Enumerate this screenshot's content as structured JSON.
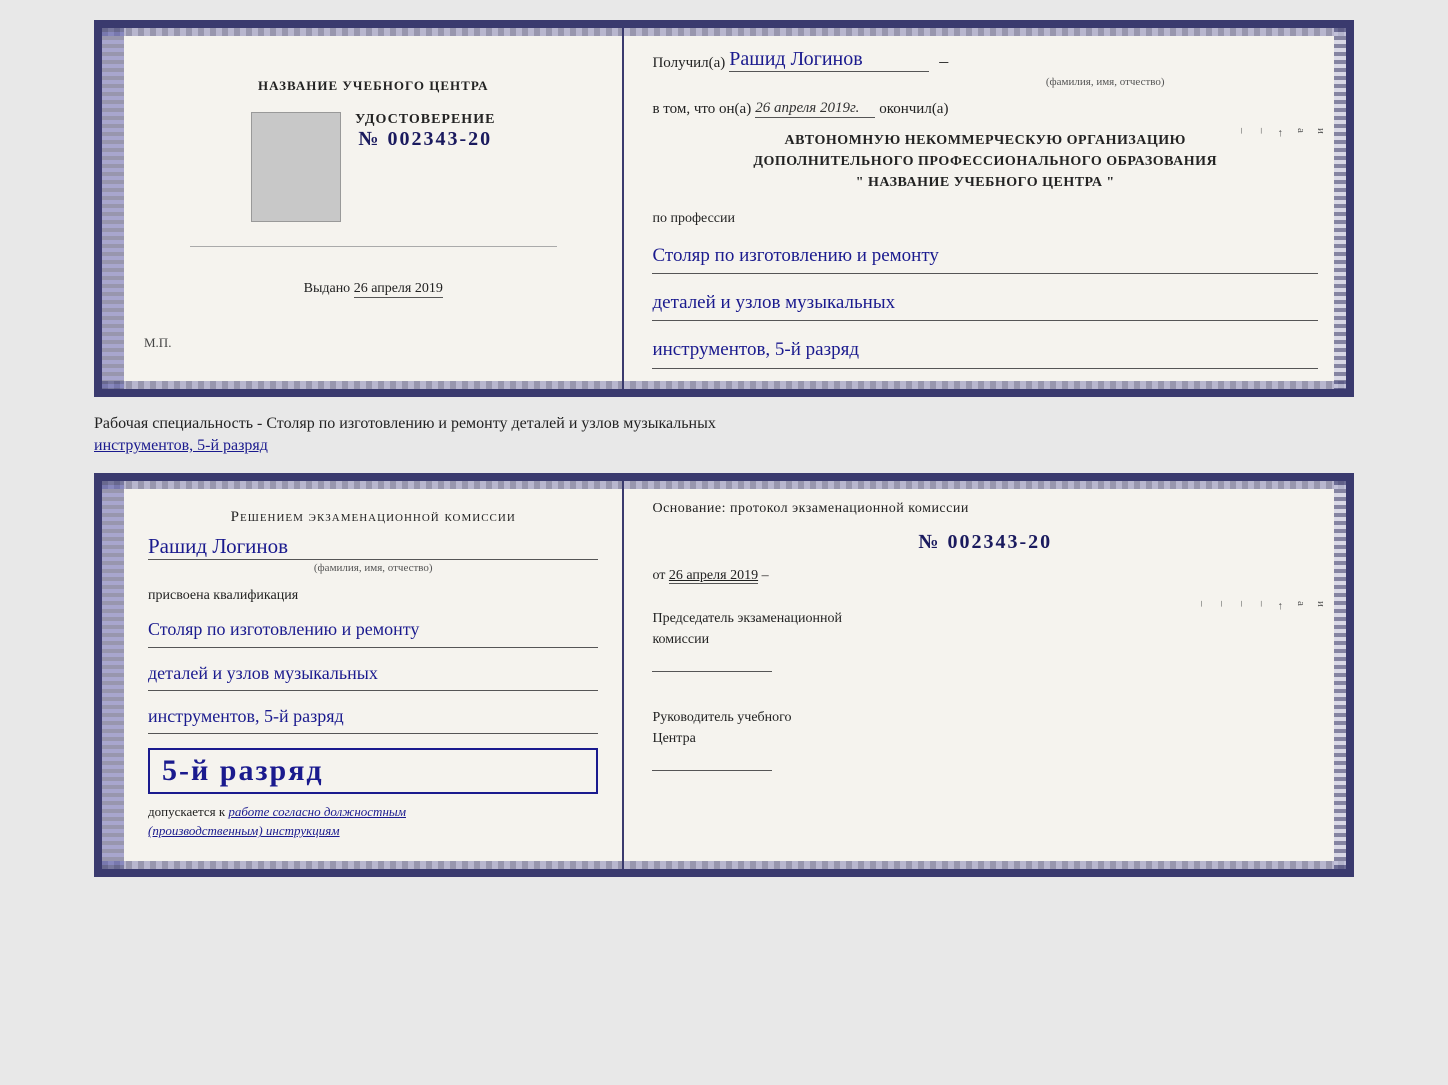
{
  "top_doc": {
    "left": {
      "center_name": "НАЗВАНИЕ УЧЕБНОГО ЦЕНТРА",
      "udost_title": "УДОСТОВЕРЕНИЕ",
      "udost_number": "№ 002343-20",
      "vydano_label": "Выдано",
      "vydano_date": "26 апреля 2019",
      "mp": "М.П."
    },
    "right": {
      "poluchil_label": "Получил(a)",
      "poluchil_name": "Рашид Логинов",
      "fio_subtitle": "(фамилия, имя, отчество)",
      "vtom_label": "в том, что он(а)",
      "vtom_date": "26 апреля 2019г.",
      "okonchil": "окончил(а)",
      "org_line1": "АВТОНОМНУЮ НЕКОММЕРЧЕСКУЮ ОРГАНИЗАЦИЮ",
      "org_line2": "ДОПОЛНИТЕЛЬНОГО ПРОФЕССИОНАЛЬНОГО ОБРАЗОВАНИЯ",
      "org_line3": "\"   НАЗВАНИЕ УЧЕБНОГО ЦЕНТРА   \"",
      "po_professii": "по профессии",
      "profession_line1": "Столяр по изготовлению и ремонту",
      "profession_line2": "деталей и узлов музыкальных",
      "profession_line3": "инструментов, 5-й разряд"
    }
  },
  "middle": {
    "text": "Рабочая специальность - Столяр по изготовлению и ремонту деталей и узлов музыкальных",
    "text2": "инструментов, 5-й разряд"
  },
  "bottom_doc": {
    "left": {
      "resheniem": "Решением экзаменационной комиссии",
      "person_name": "Рашид Логинов",
      "fio_label": "(фамилия, имя, отчество)",
      "prisvoena": "присвоена квалификация",
      "profession_line1": "Столяр по изготовлению и ремонту",
      "profession_line2": "деталей и узлов музыкальных",
      "profession_line3": "инструментов, 5-й разряд",
      "rank_text": "5-й разряд",
      "dopusk_prefix": "допускается к",
      "dopusk_text": "работе согласно должностным",
      "dopusk_text2": "(производственным) инструкциям"
    },
    "right": {
      "osnovanie": "Основание: протокол экзаменационной  комиссии",
      "protocol_number": "№  002343-20",
      "ot_label": "от",
      "ot_date": "26 апреля 2019",
      "predsedatel_line1": "Председатель экзаменационной",
      "predsedatel_line2": "комиссии",
      "rukovoditel_line1": "Руководитель учебного",
      "rukovoditel_line2": "Центра"
    }
  }
}
